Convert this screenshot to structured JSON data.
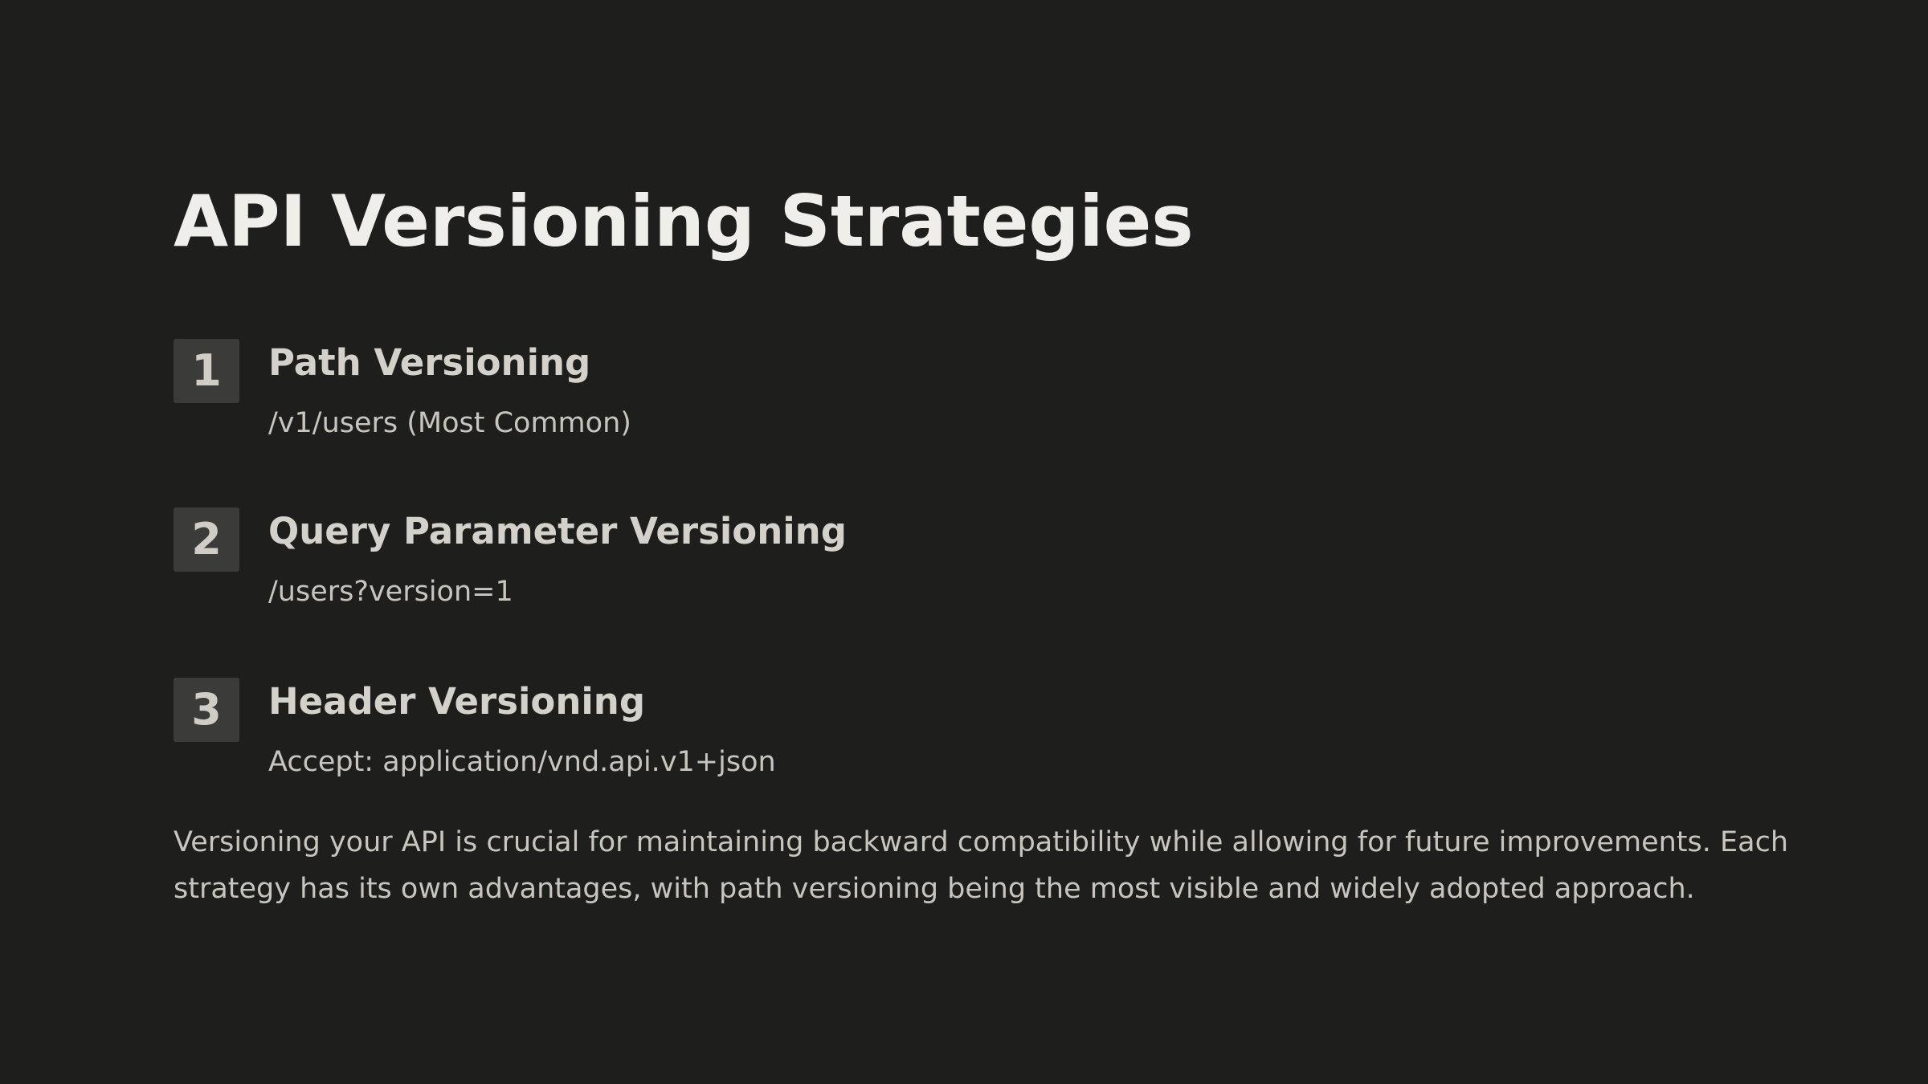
{
  "slide": {
    "title": "API Versioning Strategies",
    "strategies": [
      {
        "number": "1",
        "name": "Path Versioning",
        "example": "/v1/users (Most Common)"
      },
      {
        "number": "2",
        "name": "Query Parameter Versioning",
        "example": "/users?version=1"
      },
      {
        "number": "3",
        "name": "Header Versioning",
        "example": "Accept: application/vnd.api.v1+json"
      }
    ],
    "body": "Versioning your API is crucial for maintaining backward compatibility while allowing for future improvements. Each strategy has its own advantages, with path versioning being the most visible and widely adopted approach."
  },
  "colors": {
    "background": "#1e1e1d",
    "title": "#efeeea",
    "badge_background": "#3b3b39",
    "text": "#c7c5bd"
  }
}
